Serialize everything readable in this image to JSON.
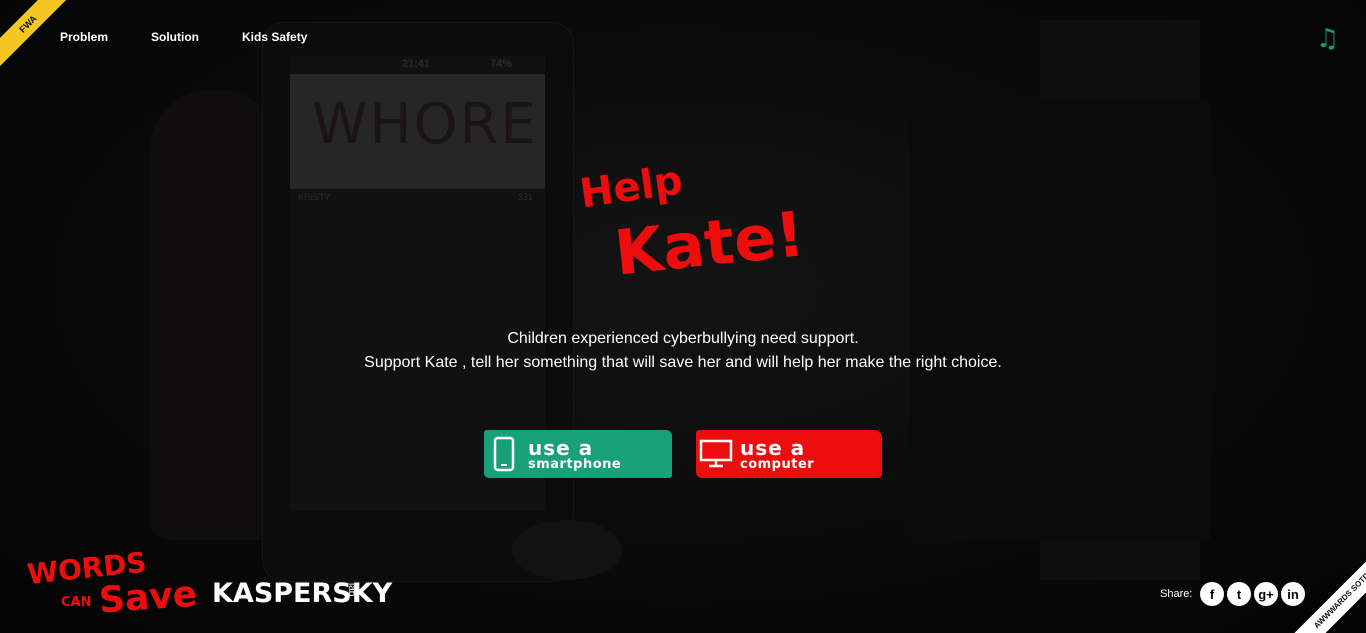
{
  "nav": {
    "items": [
      "Problem",
      "Solution",
      "Kids Safety"
    ]
  },
  "ribbon_left": {
    "label": "FWA"
  },
  "music": {
    "icon": "music-note-icon",
    "color": "#179b73"
  },
  "background_phone": {
    "time": "21:41",
    "battery": "74%",
    "photo_word": "WHORE",
    "name": "KRISTY",
    "count": "331"
  },
  "headline": {
    "line1": "Help",
    "line2": "Kate!",
    "color": "#ee0d0d"
  },
  "intro": {
    "line1": "Children experienced cyberbullying need support.",
    "line2": "Support Kate , tell her something that will save her and will help her make the right choice."
  },
  "cta": {
    "phone": {
      "line1": "use a",
      "line2": "smartphone",
      "icon": "smartphone-icon",
      "color": "#17a07a"
    },
    "computer": {
      "line1": "use a",
      "line2": "computer",
      "icon": "monitor-icon",
      "color": "#ee0d0d"
    }
  },
  "footer": {
    "campaign_logo": {
      "line1": "WORDS",
      "line2": "CAN",
      "line3": "Save"
    },
    "brand": {
      "name": "KASPERSKY",
      "suffix": "lab"
    },
    "share": {
      "label": "Share:",
      "networks": [
        {
          "name": "facebook-icon",
          "glyph": "f"
        },
        {
          "name": "twitter-icon",
          "glyph": "t"
        },
        {
          "name": "googleplus-icon",
          "glyph": "g+"
        },
        {
          "name": "linkedin-icon",
          "glyph": "in"
        }
      ]
    }
  },
  "ribbon_right": {
    "label": "AWWWARDS SOTD"
  }
}
